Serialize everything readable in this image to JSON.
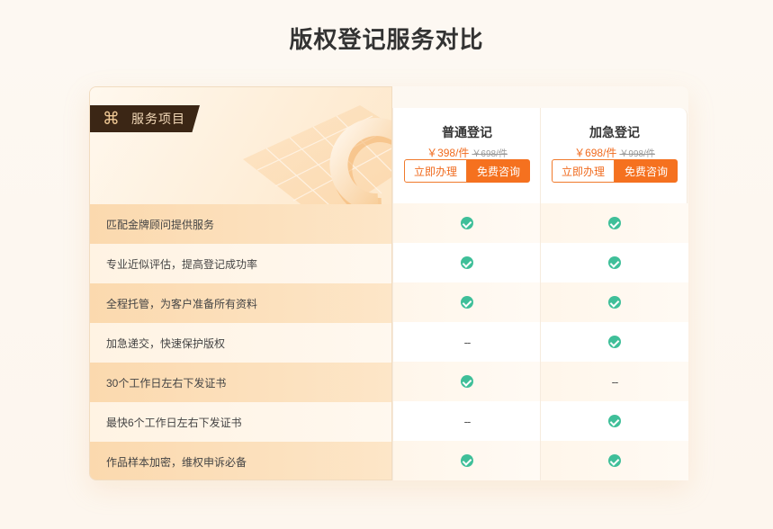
{
  "page": {
    "title": "版权登记服务对比"
  },
  "badge": {
    "icon": "command-icon",
    "label": "服务项目"
  },
  "plans": [
    {
      "name": "普通登记",
      "price": "￥398/件",
      "old_price": "￥698/件",
      "buy_label": "立即办理",
      "consult_label": "免费咨询"
    },
    {
      "name": "加急登记",
      "price": "￥698/件",
      "old_price": "￥998/件",
      "buy_label": "立即办理",
      "consult_label": "免费咨询"
    }
  ],
  "rows": [
    {
      "label": "匹配金牌顾问提供服务",
      "c1": "check",
      "c2": "check"
    },
    {
      "label": "专业近似评估，提高登记成功率",
      "c1": "check",
      "c2": "check"
    },
    {
      "label": "全程托管，为客户准备所有资料",
      "c1": "check",
      "c2": "check"
    },
    {
      "label": "加急递交，快速保护版权",
      "c1": "--",
      "c2": "check"
    },
    {
      "label": "30个工作日左右下发证书",
      "c1": "check",
      "c2": "--"
    },
    {
      "label": "最快6个工作日左右下发证书",
      "c1": "--",
      "c2": "check"
    },
    {
      "label": "作品样本加密，维权申诉必备",
      "c1": "check",
      "c2": "check"
    }
  ],
  "colors": {
    "accent": "#f5711f",
    "check": "#3fbf99",
    "badge_bg": "#3b2615"
  }
}
